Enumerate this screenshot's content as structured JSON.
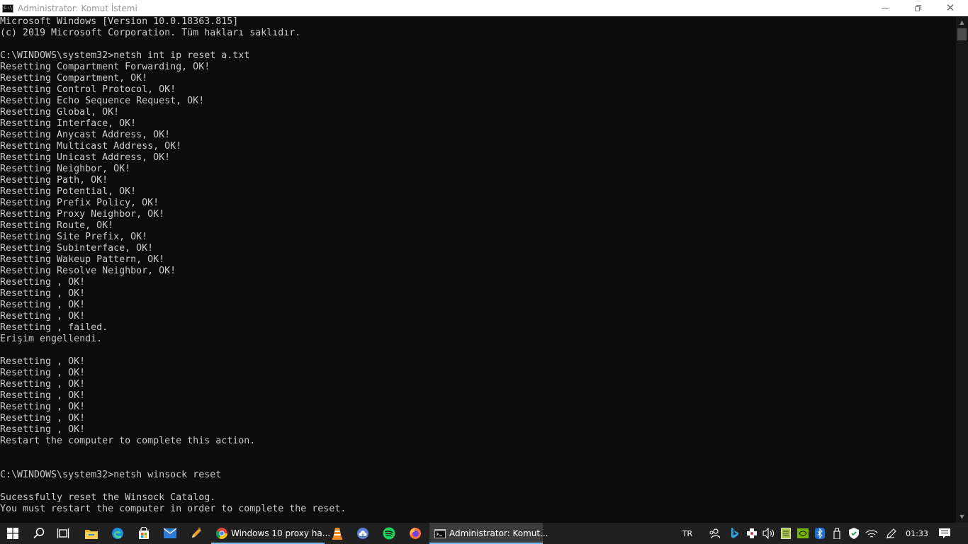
{
  "window": {
    "title": "Administrator: Komut İstemi",
    "icon": "cmd-icon",
    "icon_text": "C:\\"
  },
  "console": {
    "lines": [
      "Microsoft Windows [Version 10.0.18363.815]",
      "(c) 2019 Microsoft Corporation. Tüm hakları saklıdır.",
      "",
      "C:\\WINDOWS\\system32>netsh int ip reset a.txt",
      "Resetting Compartment Forwarding, OK!",
      "Resetting Compartment, OK!",
      "Resetting Control Protocol, OK!",
      "Resetting Echo Sequence Request, OK!",
      "Resetting Global, OK!",
      "Resetting Interface, OK!",
      "Resetting Anycast Address, OK!",
      "Resetting Multicast Address, OK!",
      "Resetting Unicast Address, OK!",
      "Resetting Neighbor, OK!",
      "Resetting Path, OK!",
      "Resetting Potential, OK!",
      "Resetting Prefix Policy, OK!",
      "Resetting Proxy Neighbor, OK!",
      "Resetting Route, OK!",
      "Resetting Site Prefix, OK!",
      "Resetting Subinterface, OK!",
      "Resetting Wakeup Pattern, OK!",
      "Resetting Resolve Neighbor, OK!",
      "Resetting , OK!",
      "Resetting , OK!",
      "Resetting , OK!",
      "Resetting , OK!",
      "Resetting , failed.",
      "Erişim engellendi.",
      "",
      "Resetting , OK!",
      "Resetting , OK!",
      "Resetting , OK!",
      "Resetting , OK!",
      "Resetting , OK!",
      "Resetting , OK!",
      "Resetting , OK!",
      "Restart the computer to complete this action.",
      "",
      "",
      "C:\\WINDOWS\\system32>netsh winsock reset",
      "",
      "Sucessfully reset the Winsock Catalog.",
      "You must restart the computer in order to complete the reset."
    ]
  },
  "taskbar": {
    "pinned": [
      {
        "name": "windows-start-icon"
      },
      {
        "name": "search-icon"
      },
      {
        "name": "task-view-icon"
      },
      {
        "name": "file-explorer-icon"
      },
      {
        "name": "edge-icon"
      },
      {
        "name": "store-icon"
      },
      {
        "name": "mail-icon"
      },
      {
        "name": "pencil-app-icon"
      }
    ],
    "open_apps": [
      {
        "name": "chrome-icon",
        "label": "Windows 10 proxy ha..."
      },
      {
        "name": "vlc-icon"
      },
      {
        "name": "download-app-icon"
      },
      {
        "name": "spotify-icon"
      },
      {
        "name": "firefox-icon"
      },
      {
        "name": "cmd-icon",
        "label": "Administrator: Komut..."
      }
    ],
    "tray": {
      "language": "TR",
      "time": "01:33"
    }
  },
  "colors": {
    "console_bg": "#0c0c0c",
    "console_fg": "#cccccc",
    "taskbar_bg": "#202020",
    "accent": "#76b9ed"
  }
}
